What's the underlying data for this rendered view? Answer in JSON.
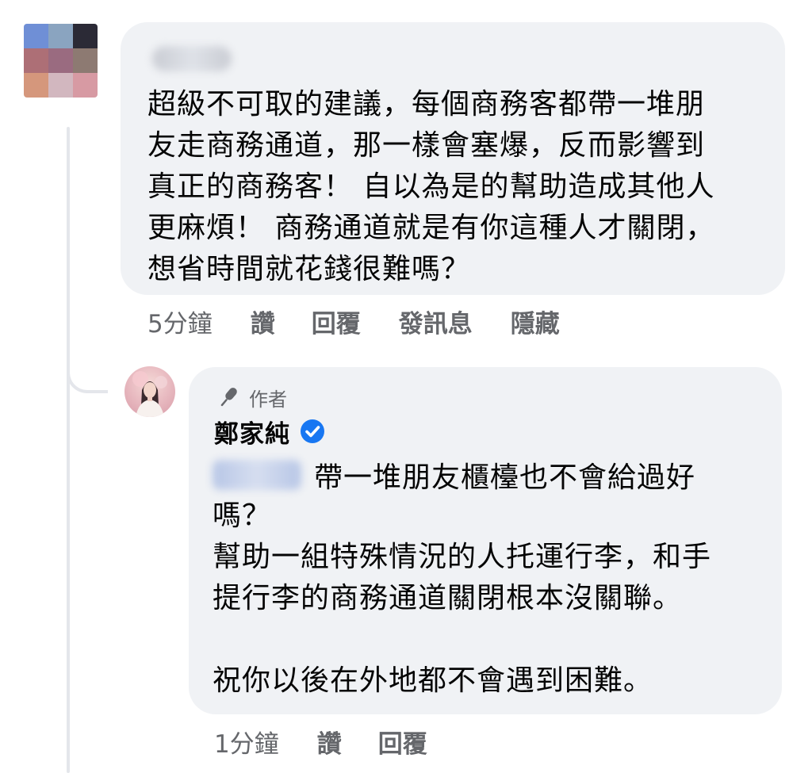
{
  "comment1": {
    "text": "超級不可取的建議，每個商務客都帶一堆朋\n友走商務通道，那一樣會塞爆，反而影響到\n真正的商務客！ 自以為是的幫助造成其他人\n更麻煩！ 商務通道就是有你這種人才關閉，\n想省時間就花錢很難嗎？",
    "actions": {
      "time": "5分鐘",
      "like": "讚",
      "reply": "回覆",
      "message": "發訊息",
      "hide": "隱藏"
    }
  },
  "reply": {
    "badge": "作者",
    "author": "鄭家純",
    "first_line": "帶一堆朋友櫃檯也不會給過好",
    "text": "嗎？\n幫助一組特殊情況的人托運行李，和手\n提行李的商務通道關閉根本沒關聯。\n\n祝你以後在外地都不會遇到困難。",
    "actions": {
      "time": "1分鐘",
      "like": "讚",
      "reply": "回覆"
    }
  },
  "colors": {
    "bubble": "#f0f2f5",
    "secondary_text": "#65676b",
    "verified": "#1877f2",
    "thread_line": "#e4e6eb"
  },
  "icons": {
    "author_badge": "microphone-icon",
    "verified": "verified-badge-icon"
  }
}
